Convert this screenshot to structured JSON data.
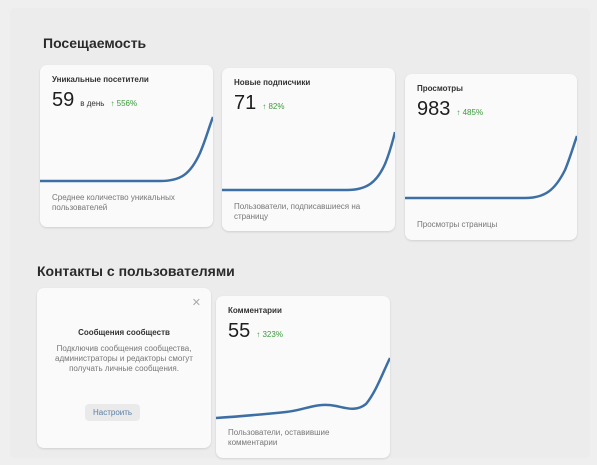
{
  "attendance": {
    "title": "Посещаемость",
    "cards": [
      {
        "title": "Уникальные посетители",
        "value": "59",
        "unit": "в день",
        "delta": "↑ 556%",
        "caption": "Среднее количество уникальных пользователей"
      },
      {
        "title": "Новые подписчики",
        "value": "71",
        "unit": "",
        "delta": "↑ 82%",
        "caption": "Пользователи, подписавшиеся на страницу"
      },
      {
        "title": "Просмотры",
        "value": "983",
        "unit": "",
        "delta": "↑ 485%",
        "caption": "Просмотры страницы"
      }
    ]
  },
  "contacts": {
    "title": "Контакты с пользователями",
    "messages_card": {
      "close_icon": "close-icon",
      "title": "Сообщения сообществ",
      "text": "Подключив сообщения сообщества, администраторы и редакторы смогут получать личные сообщения.",
      "button": "Настроить"
    },
    "comments_card": {
      "title": "Комментарии",
      "value": "55",
      "delta": "↑ 323%",
      "caption": "Пользователи, оставившие комментарии"
    }
  },
  "colors": {
    "line": "#3d6fa4",
    "delta": "#3a9a3a",
    "link": "#5a7ea6"
  }
}
